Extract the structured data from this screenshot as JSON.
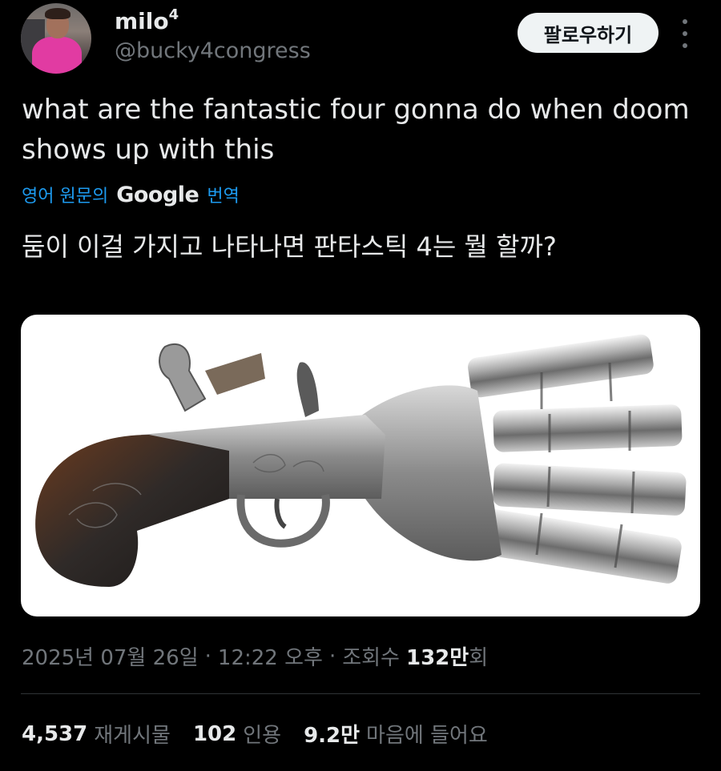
{
  "author": {
    "display_name": "milo",
    "display_name_sup": "4",
    "handle": "@bucky4congress",
    "avatar_icon": "profile-photo"
  },
  "follow_button": {
    "label": "팔로우하기"
  },
  "more_button": {
    "icon": "more-vertical-icon"
  },
  "tweet": {
    "text": "what are the fantastic four gonna do when doom shows up with this",
    "translate_prefix": "영어 원문의",
    "translate_brand": "Google",
    "translate_suffix": "번역",
    "translated_text": "둠이 이걸 가지고 나타나면 판타스틱 4는 뭘 할까?"
  },
  "meta": {
    "date": "2025년 07월 26일",
    "sep1": "·",
    "time": "12:22 오후",
    "sep2": "·",
    "views_label": "조회수",
    "views_value": "132만",
    "views_suffix": "회"
  },
  "stats": {
    "retweets_value": "4,537",
    "retweets_label": "재게시물",
    "quotes_value": "102",
    "quotes_label": "인용",
    "likes_value": "9.2만",
    "likes_label": "마음에 들어요"
  },
  "colors": {
    "background": "#000000",
    "text_primary": "#e7e9ea",
    "text_secondary": "#71767b",
    "accent": "#1d9bf0"
  }
}
